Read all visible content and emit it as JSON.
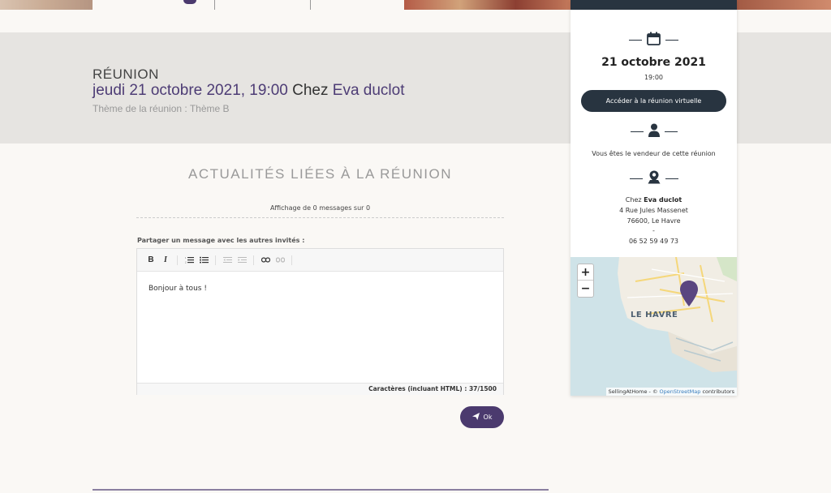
{
  "meeting": {
    "kicker": "RÉUNION",
    "datetime": "jeudi 21 octobre 2021, 19:00",
    "chez_word": "Chez",
    "host": "Eva duclot",
    "theme": "Thème de la réunion : Thème B"
  },
  "news": {
    "title": "ACTUALITÉS LIÉES À LA RÉUNION",
    "count_text": "Affichage de 0 messages sur 0",
    "share_label": "Partager un message avec les autres invités :",
    "editor_content": "Bonjour à tous !",
    "char_counter": "Caractères (incluant HTML) : 37/1500",
    "submit_label": "Ok"
  },
  "toolbar": {
    "bold": "B",
    "italic": "I"
  },
  "card": {
    "date": "21 octobre 2021",
    "time": "19:00",
    "virtual_button": "Accéder à la réunion virtuelle",
    "seller_text": "Vous êtes le vendeur de cette réunion",
    "address_prefix": "Chez",
    "address_name": "Eva duclot",
    "street": "4 Rue Jules Massenet",
    "city": "76600, Le Havre",
    "dash": "-",
    "phone": "06 52 59 49 73"
  },
  "map": {
    "city_label": "LE HAVRE",
    "zoom_in": "+",
    "zoom_out": "−",
    "attribution_prefix": "SellingAtHome - ©",
    "attribution_link": "OpenStreetMap",
    "attribution_suffix": "contributors"
  },
  "colors": {
    "brand_purple": "#4b3a6e",
    "card_dark": "#283440"
  }
}
